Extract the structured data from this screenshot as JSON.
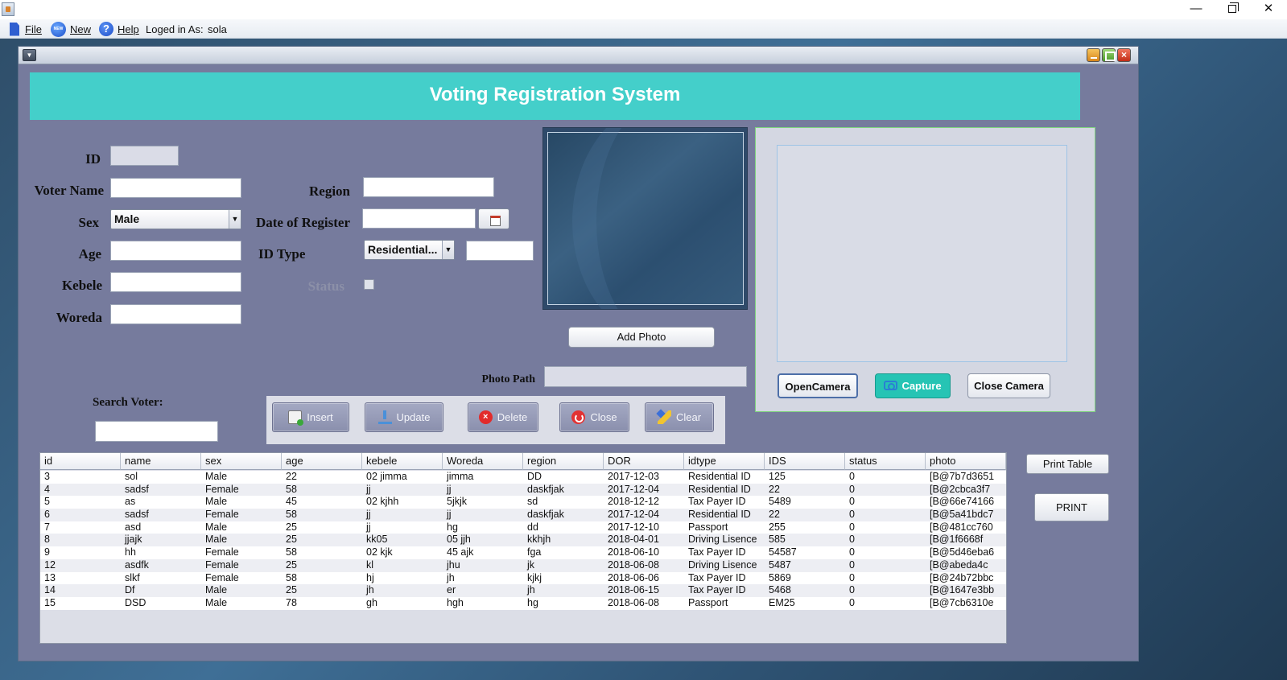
{
  "menubar": {
    "file": "File",
    "new": "New",
    "new_icon_text": "NEW",
    "help": "Help",
    "logged_label": "Loged in As:",
    "logged_user": "sola"
  },
  "form": {
    "banner": "Voting Registration System",
    "labels": {
      "id": "ID",
      "voter_name": "Voter Name",
      "sex": "Sex",
      "age": "Age",
      "kebele": "Kebele",
      "woreda": "Woreda",
      "region": "Region",
      "date_of_register": "Date of Register",
      "id_type": "ID Type",
      "status": "Status",
      "photo_path": "Photo Path",
      "search_voter": "Search Voter:"
    },
    "sex_value": "Male",
    "id_type_value": "Residential...",
    "add_photo": "Add Photo"
  },
  "camera": {
    "open": "OpenCamera",
    "capture": "Capture",
    "close": "Close Camera"
  },
  "actions": {
    "insert": "Insert",
    "update": "Update",
    "delete": "Delete",
    "close": "Close",
    "clear": "Clear"
  },
  "side": {
    "print_table": "Print Table",
    "print": "PRINT"
  },
  "table": {
    "columns": [
      "id",
      "name",
      "sex",
      "age",
      "kebele",
      "Woreda",
      "region",
      "DOR",
      "idtype",
      "IDS",
      "status",
      "photo"
    ],
    "rows": [
      [
        "3",
        "sol",
        "Male",
        "22",
        "02 jimma",
        "jimma",
        "DD",
        "2017-12-03",
        "Residential ID",
        "125",
        "0",
        "[B@7b7d3651"
      ],
      [
        "4",
        "sadsf",
        "Female",
        "58",
        "jj",
        "jj",
        "daskfjak",
        "2017-12-04",
        "Residential ID",
        "22",
        "0",
        "[B@2cbca3f7"
      ],
      [
        "5",
        "as",
        "Male",
        "45",
        "02 kjhh",
        "5jkjk",
        "sd",
        "2018-12-12",
        "Tax Payer ID",
        "5489",
        "0",
        "[B@66e74166"
      ],
      [
        "6",
        "sadsf",
        "Female",
        "58",
        "jj",
        "jj",
        "daskfjak",
        "2017-12-04",
        "Residential ID",
        "22",
        "0",
        "[B@5a41bdc7"
      ],
      [
        "7",
        "asd",
        "Male",
        "25",
        "jj",
        "hg",
        "dd",
        "2017-12-10",
        "Passport",
        "255",
        "0",
        "[B@481cc760"
      ],
      [
        "8",
        "jjajk",
        "Male",
        "25",
        "kk05",
        "05 jjh",
        "kkhjh",
        "2018-04-01",
        "Driving Lisence",
        "585",
        "0",
        "[B@1f6668f"
      ],
      [
        "9",
        "hh",
        "Female",
        "58",
        "02 kjk",
        "45 ajk",
        "fga",
        "2018-06-10",
        "Tax Payer ID",
        "54587",
        "0",
        "[B@5d46eba6"
      ],
      [
        "12",
        "asdfk",
        "Female",
        "25",
        "kl",
        "jhu",
        "jk",
        "2018-06-08",
        "Driving Lisence",
        "5487",
        "0",
        "[B@abeda4c"
      ],
      [
        "13",
        "slkf",
        "Female",
        "58",
        "hj",
        "jh",
        "kjkj",
        "2018-06-06",
        "Tax Payer ID",
        "5869",
        "0",
        "[B@24b72bbc"
      ],
      [
        "14",
        "Df",
        "Male",
        "25",
        "jh",
        "er",
        "jh",
        "2018-06-15",
        "Tax Payer ID",
        "5468",
        "0",
        "[B@1647e3bb"
      ],
      [
        "15",
        "DSD",
        "Male",
        "78",
        "gh",
        "hgh",
        "hg",
        "2018-06-08",
        "Passport",
        "EM25",
        "0",
        "[B@7cb6310e"
      ]
    ]
  }
}
